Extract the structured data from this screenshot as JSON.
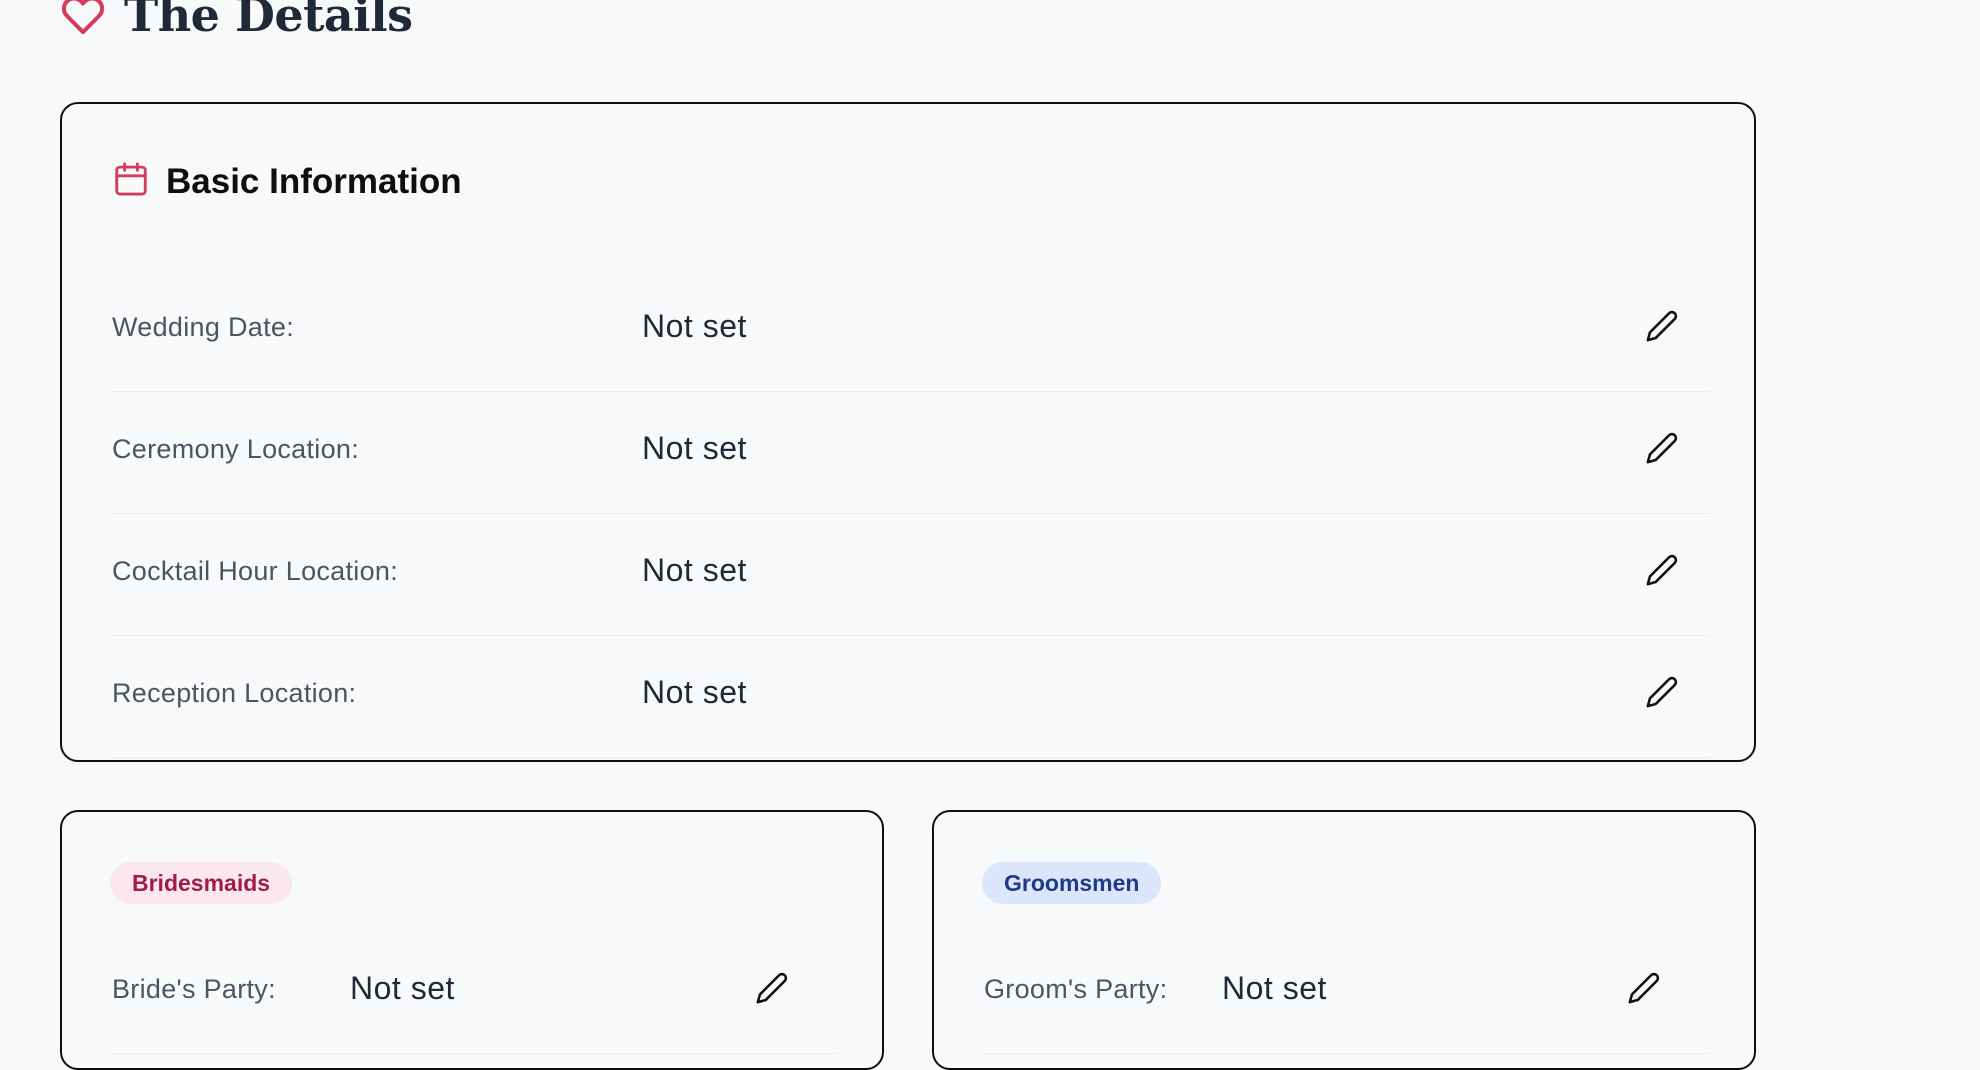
{
  "page": {
    "title": "The Details",
    "icon": "heart-icon",
    "accent_color": "#d43a5a"
  },
  "basic_info": {
    "title": "Basic Information",
    "icon": "calendar-icon",
    "rows": [
      {
        "label": "Wedding Date:",
        "value": "Not set",
        "action_icon": "pencil-icon"
      },
      {
        "label": "Ceremony Location:",
        "value": "Not set",
        "action_icon": "pencil-icon"
      },
      {
        "label": "Cocktail Hour Location:",
        "value": "Not set",
        "action_icon": "pencil-icon"
      },
      {
        "label": "Reception Location:",
        "value": "Not set",
        "action_icon": "pencil-icon"
      }
    ]
  },
  "bridesmaids": {
    "badge": "Bridesmaids",
    "badge_color": "#9f1d4a",
    "badge_bg": "#fce7ee",
    "row": {
      "label": "Bride's Party:",
      "value": "Not set",
      "action_icon": "pencil-icon"
    }
  },
  "groomsmen": {
    "badge": "Groomsmen",
    "badge_color": "#1e3a8a",
    "badge_bg": "#dbe6fb",
    "row": {
      "label": "Groom's Party:",
      "value": "Not set",
      "action_icon": "pencil-icon"
    }
  }
}
